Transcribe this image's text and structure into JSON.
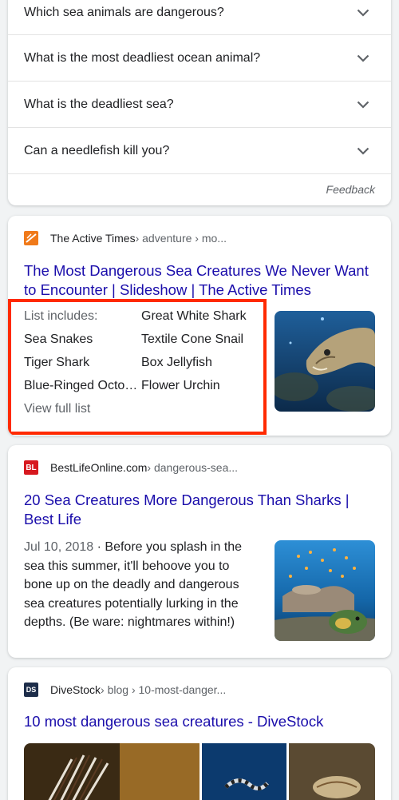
{
  "paa": {
    "questions": [
      "Which sea animals are dangerous?",
      "What is the most deadliest ocean animal?",
      "What is the deadliest sea?",
      "Can a needlefish kill you?"
    ],
    "feedback": "Feedback"
  },
  "result1": {
    "site": "The Active Times",
    "crumbs": " › adventure › mo...",
    "title": "The Most Dangerous Sea Creatures We Never Want to Encounter | Slideshow | The Active Times",
    "list_label": "List includes:",
    "items": [
      "Great White Shark",
      "Sea Snakes",
      "Textile Cone Snail",
      "Tiger Shark",
      "Box Jellyfish",
      "Blue-Ringed Octo…",
      "Flower Urchin"
    ],
    "view_full": "View full list",
    "highlight_color": "#ff2a00"
  },
  "result2": {
    "favicon_text": "BL",
    "site": "BestLifeOnline.com",
    "crumbs": " › dangerous-sea...",
    "title": "20 Sea Creatures More Dangerous Than Sharks | Best Life",
    "date": "Jul 10, 2018",
    "snippet": " · Before you splash in the sea this summer, it'll behoove you to bone up on the deadly and dangerous sea creatures potentially lurking in the depths. (Be ware: nightmares within!)"
  },
  "result3": {
    "favicon_text": "DS",
    "site": "DiveStock",
    "crumbs": " › blog › 10-most-danger...",
    "title": "10 most dangerous sea creatures - DiveStock"
  },
  "colors": {
    "link": "#1a0dab",
    "text": "#202124",
    "muted": "#5f6368"
  }
}
